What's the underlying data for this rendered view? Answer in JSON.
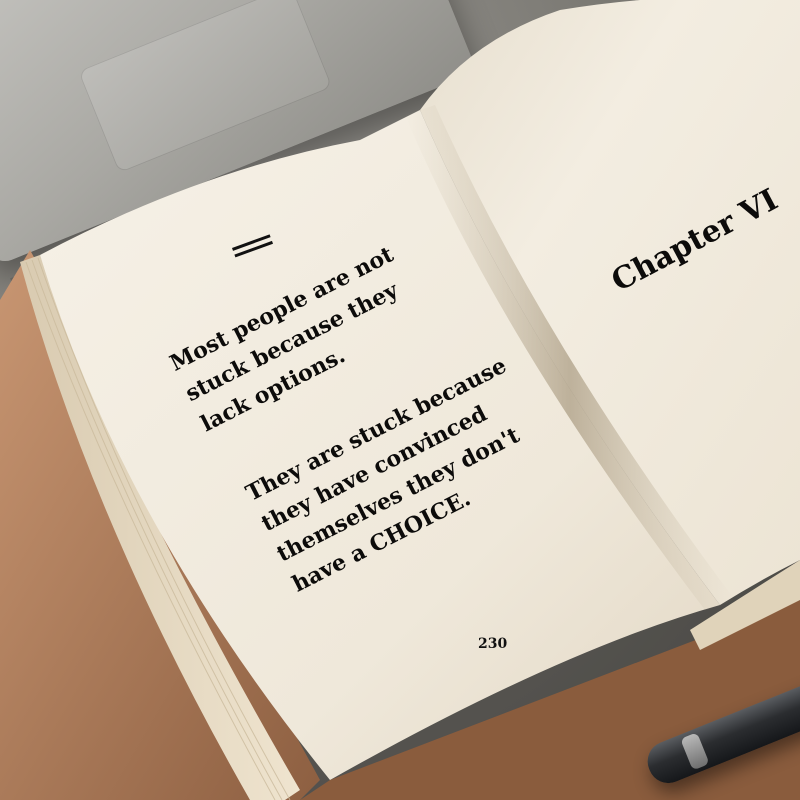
{
  "book": {
    "left_page": {
      "paragraph_1": [
        "Most people are not",
        "stuck because they",
        "lack options."
      ],
      "paragraph_2": [
        "They are stuck because",
        "they have convinced",
        "themselves they don't",
        "have a CHOICE."
      ],
      "page_number": "230"
    },
    "right_page": {
      "chapter_title": "Chapter VI"
    }
  },
  "colors": {
    "page": "#f1ebdf",
    "desk": "#7e7c78",
    "cover": "#b88563",
    "text": "#0c0b0a"
  },
  "icons": {
    "section_mark": "double-rule-icon"
  }
}
